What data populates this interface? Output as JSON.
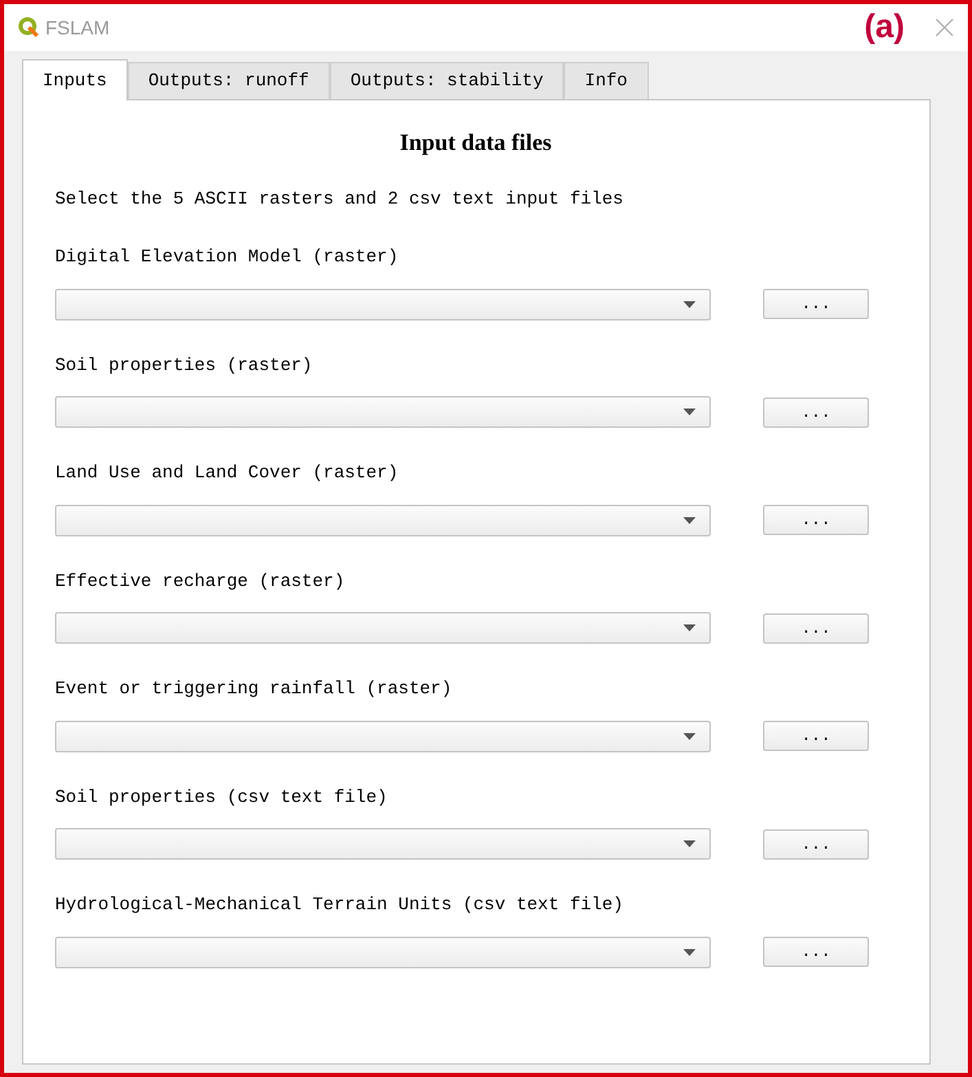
{
  "window": {
    "title": "FSLAM",
    "figure_label": "(a)"
  },
  "tabs": [
    {
      "label": "Inputs",
      "selected": true
    },
    {
      "label": "Outputs: runoff",
      "selected": false
    },
    {
      "label": "Outputs: stability",
      "selected": false
    },
    {
      "label": "Info",
      "selected": false
    }
  ],
  "heading": "Input data files",
  "instruction": "Select the 5 ASCII rasters and 2 csv text input files",
  "fields": [
    {
      "label": "Digital Elevation Model (raster)",
      "button": "..."
    },
    {
      "label": "Soil properties (raster)",
      "button": "..."
    },
    {
      "label": "Land Use and Land Cover (raster)",
      "button": "..."
    },
    {
      "label": "Effective recharge (raster)",
      "button": "..."
    },
    {
      "label": "Event or triggering rainfall (raster)",
      "button": "..."
    },
    {
      "label": "Soil properties (csv text file)",
      "button": "..."
    },
    {
      "label": "Hydrological-Mechanical Terrain Units (csv text file)",
      "button": "..."
    }
  ]
}
